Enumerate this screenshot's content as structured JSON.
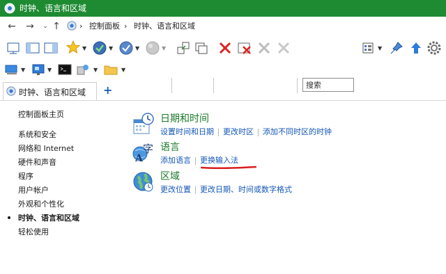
{
  "window": {
    "title": "时钟、语言和区域"
  },
  "address": {
    "root": "控制面板",
    "current": "时钟、语言和区域"
  },
  "toolbar": {
    "search_placeholder": "搜索"
  },
  "tab": {
    "label": "时钟、语言和区域",
    "new_tab": "+"
  },
  "sidebar": {
    "items": [
      {
        "label": "控制面板主页"
      },
      {
        "label": "系统和安全"
      },
      {
        "label": "网络和 Internet"
      },
      {
        "label": "硬件和声音"
      },
      {
        "label": "程序"
      },
      {
        "label": "用户帐户"
      },
      {
        "label": "外观和个性化"
      },
      {
        "label": "时钟、语言和区域",
        "active": true
      },
      {
        "label": "轻松使用"
      }
    ]
  },
  "categories": [
    {
      "title": "日期和时间",
      "links": [
        "设置时间和日期",
        "更改时区",
        "添加不同时区的时钟"
      ]
    },
    {
      "title": "语言",
      "links": [
        "添加语言",
        "更换输入法"
      ]
    },
    {
      "title": "区域",
      "links": [
        "更改位置",
        "更改日期、时间或数字格式"
      ]
    }
  ],
  "colors": {
    "titlebar": "#1e8b32",
    "heading": "#1a7a2a",
    "link": "#1357b8",
    "annotation": "#d81e1e"
  }
}
